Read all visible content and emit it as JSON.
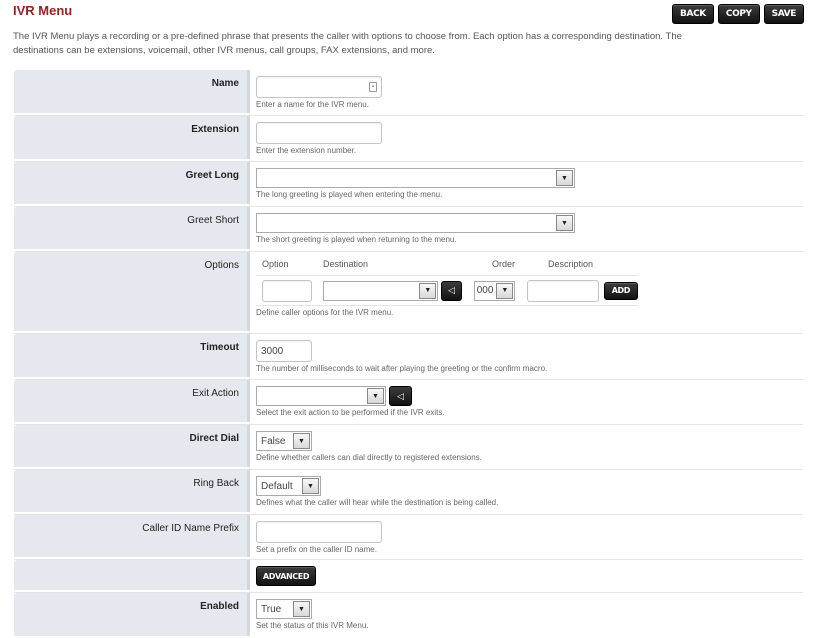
{
  "header": {
    "title": "IVR Menu",
    "description": "The IVR Menu plays a recording or a pre-defined phrase that presents the caller with options to choose from. Each option has a corresponding destination. The destinations can be extensions, voicemail, other IVR menus, call groups, FAX extensions, and more.",
    "buttons": {
      "back": "BACK",
      "copy": "COPY",
      "save": "SAVE"
    }
  },
  "icons": {
    "dropdown": "▼",
    "play": "◁",
    "name_field": "⍗"
  },
  "colors": {
    "title": "#952424",
    "label_bg": "#e5e8ee",
    "button_bg": "#1e1e1e"
  },
  "form": {
    "name": {
      "label": "Name",
      "value": "",
      "hint": "Enter a name for the IVR menu."
    },
    "extension": {
      "label": "Extension",
      "value": "",
      "hint": "Enter the extension number."
    },
    "greet_long": {
      "label": "Greet Long",
      "value": "",
      "hint": "The long greeting is played when entering the menu."
    },
    "greet_short": {
      "label": "Greet Short",
      "value": "",
      "hint": "The short greeting is played when returning to the menu."
    },
    "options": {
      "label": "Options",
      "columns": {
        "option": "Option",
        "destination": "Destination",
        "order": "Order",
        "description": "Description"
      },
      "row": {
        "option": "",
        "destination": "",
        "order": "000",
        "description": ""
      },
      "add_label": "ADD",
      "hint": "Define caller options for the IVR menu."
    },
    "timeout": {
      "label": "Timeout",
      "value": "3000",
      "hint": "The number of milliseconds to wait after playing the greeting or the confirm macro."
    },
    "exit_action": {
      "label": "Exit Action",
      "value": "",
      "hint": "Select the exit action to be performed if the IVR exits."
    },
    "direct_dial": {
      "label": "Direct Dial",
      "value": "False",
      "hint": "Define whether callers can dial directly to registered extensions."
    },
    "ring_back": {
      "label": "Ring Back",
      "value": "Default",
      "hint": "Defines what the caller will hear while the destination is being called."
    },
    "caller_id_prefix": {
      "label": "Caller ID Name Prefix",
      "value": "",
      "hint": "Set a prefix on the caller ID name."
    },
    "advanced_label": "ADVANCED",
    "enabled": {
      "label": "Enabled",
      "value": "True",
      "hint": "Set the status of this IVR Menu."
    }
  }
}
